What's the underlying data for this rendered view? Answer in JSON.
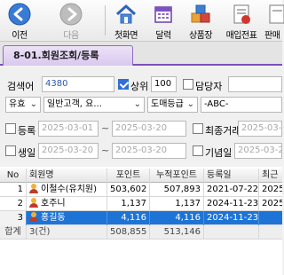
{
  "toolbar": {
    "items": [
      {
        "label": "이전",
        "icon": "back-arrow-icon",
        "enabled": true
      },
      {
        "label": "다음",
        "icon": "forward-arrow-icon",
        "enabled": false
      },
      {
        "label": "첫화면",
        "icon": "home-icon",
        "enabled": true
      },
      {
        "label": "달력",
        "icon": "calendar-icon",
        "enabled": true
      },
      {
        "label": "상품장",
        "icon": "product-ledger-icon",
        "enabled": true
      },
      {
        "label": "매입전표",
        "icon": "purchase-slip-icon",
        "enabled": true
      },
      {
        "label": "판매",
        "icon": "sales-icon",
        "enabled": true
      }
    ]
  },
  "title": "8-01.회원조회/등록",
  "search": {
    "label": "검색어",
    "value": "4380",
    "rank_checkbox_label": "상위",
    "rank_checked": true,
    "rank_value": "100",
    "manager_label": "담당자",
    "manager_checked": false
  },
  "filters": {
    "type_value": "유효",
    "customer_value": "일반고객, 요...",
    "grade_value": "도매등급",
    "grade_text": "-ABC-"
  },
  "dates": {
    "reg_label": "등록",
    "reg_from": "2025-03-01",
    "reg_to": "2025-03-20",
    "last_trade_label": "최종거래",
    "last_trade_from": "2025-03-0",
    "birth_label": "생일",
    "birth_from": "2025-03-20",
    "birth_to": "2025-03-20",
    "anniv_label": "기념일",
    "anniv_from": "2025-03-2"
  },
  "grid": {
    "headers": [
      "No",
      "회원명",
      "포인트",
      "누적포인트",
      "등록일",
      "최근"
    ],
    "rows": [
      {
        "no": "1",
        "name": "이철수(유치원)",
        "points": "503,602",
        "total": "507,893",
        "reg": "2021-07-22",
        "recent": "2025"
      },
      {
        "no": "2",
        "name": "호주니",
        "points": "1,137",
        "total": "1,137",
        "reg": "2024-11-23",
        "recent": "2025"
      },
      {
        "no": "3",
        "name": "홍길동",
        "points": "4,116",
        "total": "4,116",
        "reg": "2024-11-23",
        "recent": ""
      }
    ],
    "selected_row": 3,
    "footer": {
      "label": "합계",
      "count": "3(건)",
      "points": "508,855",
      "total": "513,146"
    }
  },
  "colors": {
    "accent": "#7c4fb8",
    "selection": "#1e74d6",
    "search_value": "#2a55b8"
  }
}
